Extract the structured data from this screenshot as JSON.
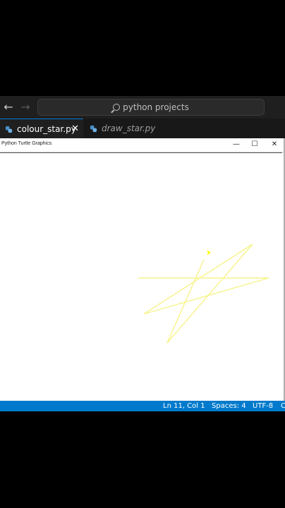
{
  "editor": {
    "search_text": "python projects",
    "tabs": [
      {
        "label": "colour_star.py",
        "close_symbol": "✕"
      },
      {
        "label": "draw_star.py"
      }
    ]
  },
  "turtle_window": {
    "title": "Python Turtle Graphics",
    "min_symbol": "—",
    "max_symbol": "☐",
    "close_symbol": "✕",
    "stroke_color": "#f7f38a",
    "turtle_color": "#ffff00"
  },
  "statusbar": {
    "position": "Ln 11, Col 1",
    "spaces": "Spaces: 4",
    "encoding": "UTF-8",
    "cut_char": "C"
  },
  "colors": {
    "accent": "#007acc",
    "titlebar": "#1f1f1f",
    "tabbar": "#181818"
  }
}
